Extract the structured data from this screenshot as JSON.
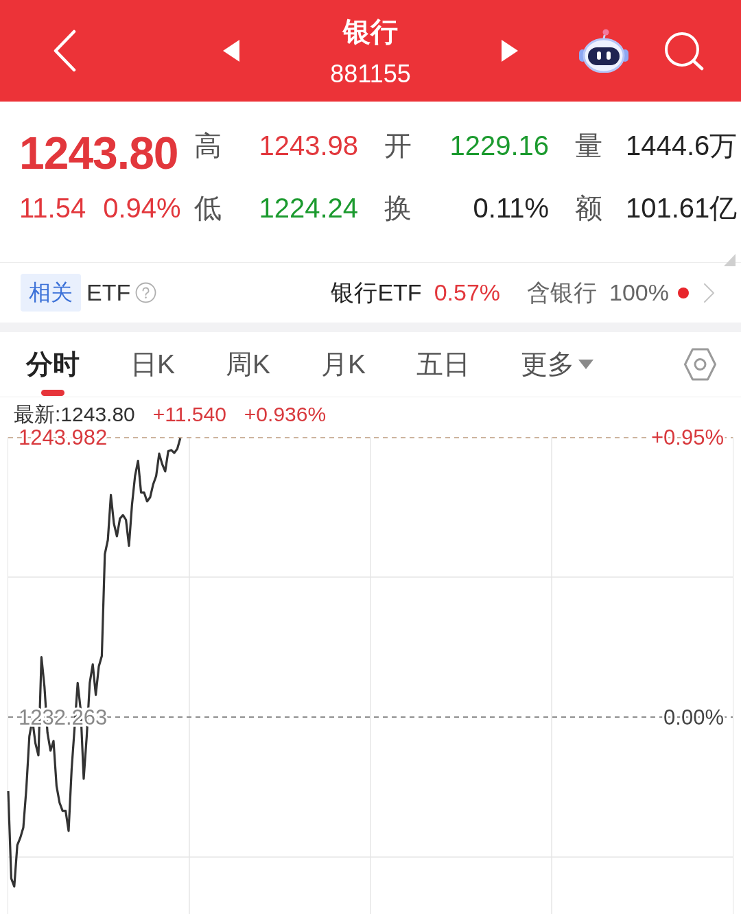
{
  "header": {
    "title": "银行",
    "code": "881155"
  },
  "quote": {
    "price": "1243.80",
    "change": "11.54",
    "change_pct": "0.94%",
    "rising": true
  },
  "stats": [
    {
      "label": "高",
      "value": "1243.98",
      "color": "#e2373c"
    },
    {
      "label": "开",
      "value": "1229.16",
      "color": "#1b9a2e"
    },
    {
      "label": "量",
      "value": "1444.6万",
      "color": "#222222"
    },
    {
      "label": "低",
      "value": "1224.24",
      "color": "#1b9a2e"
    },
    {
      "label": "换",
      "value": "0.11%",
      "color": "#222222"
    },
    {
      "label": "额",
      "value": "101.61亿",
      "color": "#222222"
    }
  ],
  "related_etf": {
    "tag": "相关",
    "label": "ETF",
    "name": "银行ETF",
    "change": "0.57%",
    "rising": true,
    "holding_label": "含银行",
    "holding_pct": "100%",
    "notice_dot": true
  },
  "tabs": [
    {
      "label": "分时",
      "selected": true,
      "kind": "tab"
    },
    {
      "label": "日K",
      "selected": false,
      "kind": "tab"
    },
    {
      "label": "周K",
      "selected": false,
      "kind": "tab"
    },
    {
      "label": "月K",
      "selected": false,
      "kind": "tab"
    },
    {
      "label": "五日",
      "selected": false,
      "kind": "tab"
    },
    {
      "label": "更多",
      "selected": false,
      "kind": "menu"
    }
  ],
  "chart": {
    "latest": "最新:1243.80",
    "change": "+11.540",
    "change_pct": "+0.936%",
    "rising": true,
    "right_labels": [
      {
        "text": "+0.95%",
        "color": "#d8393d"
      },
      {
        "text": "0.00%",
        "color": "#444444"
      }
    ],
    "chart_data": {
      "type": "line",
      "categories": [
        null,
        null,
        null,
        null,
        null,
        null,
        null,
        null,
        null,
        null,
        null,
        null,
        null,
        null,
        null,
        null,
        null,
        null,
        null,
        null,
        null,
        null,
        null,
        null,
        null,
        null,
        null,
        null,
        null,
        null,
        null,
        null,
        null,
        null,
        null,
        null,
        null,
        null,
        null,
        null,
        null,
        null,
        null,
        null,
        null,
        null,
        null,
        null,
        null,
        null,
        null,
        null,
        null,
        null,
        null,
        null,
        null,
        null,
        null,
        null,
        null,
        null,
        null,
        null,
        null,
        null,
        null,
        null,
        null,
        null,
        null,
        null,
        null,
        null,
        null,
        null,
        null,
        null,
        null,
        null,
        null,
        null,
        null,
        null,
        null,
        null,
        null,
        null,
        null,
        null,
        null,
        null,
        null,
        null,
        null,
        null,
        null,
        null,
        null,
        null,
        null,
        null,
        null,
        null,
        null,
        null,
        null,
        null,
        null,
        null,
        null,
        null,
        null,
        null,
        null,
        null,
        null,
        null,
        null,
        null,
        null,
        null,
        null,
        null,
        null,
        null,
        null,
        null,
        null,
        null,
        null,
        null,
        null,
        null,
        null,
        null,
        null,
        null,
        null,
        null,
        null,
        null,
        null,
        null,
        null,
        null,
        null,
        null,
        null,
        null,
        null,
        null,
        null,
        null,
        null,
        null,
        null,
        null,
        null,
        null,
        null,
        null,
        null,
        null,
        null,
        null,
        null,
        null,
        null,
        null,
        null,
        null,
        null,
        null,
        null,
        null,
        null,
        null,
        null,
        null,
        null,
        null,
        null,
        null,
        null,
        null,
        null,
        null,
        null,
        null,
        null,
        null,
        null,
        null,
        null,
        null,
        null,
        null,
        null,
        null,
        null,
        null,
        null,
        null,
        null,
        null,
        null,
        null,
        null,
        null,
        null,
        null,
        null,
        null,
        null,
        null,
        null,
        null,
        null,
        null,
        null,
        null,
        null,
        null,
        null,
        null,
        null,
        null,
        null,
        null,
        null,
        null,
        null,
        null,
        null,
        null,
        null,
        null,
        null,
        null,
        null
      ],
      "series": [
        {
          "color": "#333333",
          "values": [
            1229.16,
            1225.51,
            1225.17,
            1226.9,
            1227.21,
            1227.64,
            1229.28,
            1231.46,
            1232.15,
            1231.17,
            1230.66,
            1234.77,
            1233.54,
            1231.6,
            1230.86,
            1231.26,
            1229.38,
            1228.68,
            1228.34,
            1228.34,
            1227.5,
            1230.08,
            1231.86,
            1233.69,
            1232.55,
            1229.68,
            1231.46,
            1233.69,
            1234.47,
            1233.19,
            1234.38,
            1234.82,
            1239.08,
            1239.68,
            1241.56,
            1240.37,
            1239.83,
            1240.57,
            1240.72,
            1240.52,
            1239.43,
            1241.16,
            1242.35,
            1242.99,
            1241.66,
            1241.66,
            1241.29,
            1241.46,
            1242.0,
            1242.35,
            1243.29,
            1242.85,
            1242.55,
            1243.39,
            1243.44,
            1243.32,
            1243.49,
            1243.94,
            null,
            null,
            null,
            null,
            null,
            null,
            null,
            null,
            null,
            null,
            null,
            null,
            null,
            null,
            null,
            null,
            null,
            null,
            null,
            null,
            null,
            null,
            null,
            null,
            null,
            null,
            null,
            null,
            null,
            null,
            null,
            null,
            null,
            null,
            null,
            null,
            null,
            null,
            null,
            null,
            null,
            null,
            null,
            null,
            null,
            null,
            null,
            null,
            null,
            null,
            null,
            null,
            null,
            null,
            null,
            null,
            null,
            null,
            null,
            null,
            null,
            null,
            null,
            null,
            null,
            null,
            null,
            null,
            null,
            null,
            null,
            null,
            null,
            null,
            null,
            null,
            null,
            null,
            null,
            null,
            null,
            null,
            null,
            null,
            null,
            null,
            null,
            null,
            null,
            null,
            null,
            null,
            null,
            null,
            null,
            null,
            null,
            null,
            null,
            null,
            null,
            null,
            null,
            null,
            null,
            null,
            null,
            null,
            null,
            null,
            null,
            null,
            null,
            null,
            null,
            null,
            null,
            null,
            null,
            null,
            null,
            null,
            null,
            null,
            null,
            null,
            null,
            null,
            null,
            null,
            null,
            null,
            null,
            null,
            null,
            null,
            null,
            null,
            null,
            null,
            null,
            null,
            null,
            null,
            null,
            null,
            null,
            null,
            null,
            null,
            null,
            null,
            null,
            null,
            null,
            null,
            null,
            null,
            null,
            null,
            null,
            null,
            null,
            null,
            null,
            null,
            null,
            null,
            null,
            null,
            null,
            null,
            null,
            null,
            null,
            null,
            null,
            null,
            null,
            null,
            null,
            null,
            null
          ]
        }
      ],
      "ylim": [
        1224.02,
        1243.982
      ],
      "yticks": [
        {
          "value": 1243.982,
          "label": "1243.982"
        },
        {
          "value": 1232.263,
          "label": "1232.263"
        }
      ],
      "ref_lines": [
        {
          "axis": "y",
          "value": 1232.263
        }
      ]
    }
  }
}
